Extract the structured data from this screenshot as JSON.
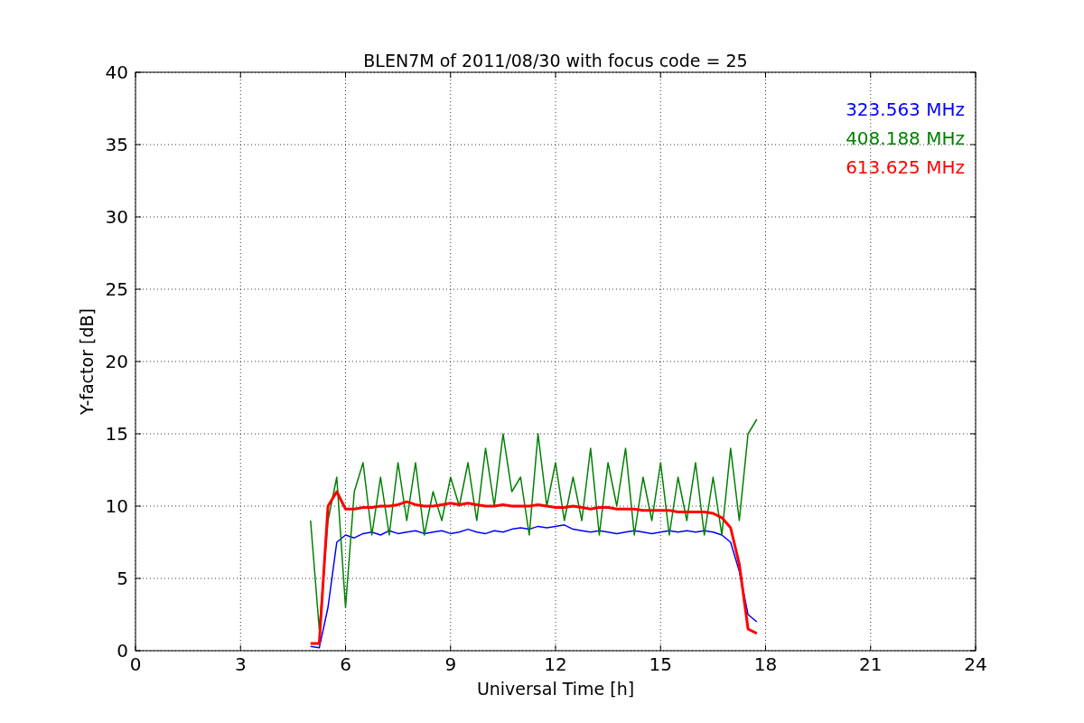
{
  "chart_data": {
    "type": "line",
    "grid": true,
    "title": "BLEN7M of 2011/08/30 with focus code = 25",
    "xlabel": "Universal Time [h]",
    "ylabel": "Y-factor [dB]",
    "xlim": [
      0,
      24
    ],
    "ylim": [
      0,
      40
    ],
    "xticks": [
      0,
      3,
      6,
      9,
      12,
      15,
      18,
      21,
      24
    ],
    "yticks": [
      0,
      5,
      10,
      15,
      20,
      25,
      30,
      35,
      40
    ],
    "x": [
      5,
      5.25,
      5.5,
      5.75,
      6,
      6.25,
      6.5,
      6.75,
      7,
      7.25,
      7.5,
      7.75,
      8,
      8.25,
      8.5,
      8.75,
      9,
      9.25,
      9.5,
      9.75,
      10,
      10.25,
      10.5,
      10.75,
      11,
      11.25,
      11.5,
      11.75,
      12,
      12.25,
      12.5,
      12.75,
      13,
      13.25,
      13.5,
      13.75,
      14,
      14.25,
      14.5,
      14.75,
      15,
      15.25,
      15.5,
      15.75,
      16,
      16.25,
      16.5,
      16.75,
      17,
      17.25,
      17.5,
      17.75
    ],
    "series": [
      {
        "name": "323.563 MHz",
        "color": "#0000ff",
        "values": [
          0.3,
          0.2,
          3,
          7.5,
          8,
          7.8,
          8.1,
          8.2,
          8.0,
          8.3,
          8.1,
          8.2,
          8.3,
          8.1,
          8.2,
          8.3,
          8.1,
          8.2,
          8.4,
          8.2,
          8.1,
          8.3,
          8.2,
          8.4,
          8.5,
          8.4,
          8.6,
          8.5,
          8.6,
          8.7,
          8.4,
          8.3,
          8.2,
          8.3,
          8.2,
          8.1,
          8.2,
          8.3,
          8.2,
          8.1,
          8.2,
          8.3,
          8.2,
          8.3,
          8.2,
          8.3,
          8.2,
          8.0,
          7.5,
          5.5,
          2.5,
          2
        ]
      },
      {
        "name": "408.188 MHz",
        "color": "#008000",
        "values": [
          9,
          1.5,
          9,
          12,
          3,
          11,
          13,
          8,
          12,
          8,
          13,
          9,
          13,
          8,
          11,
          9,
          12,
          10,
          13,
          9,
          14,
          10,
          15,
          11,
          12,
          8,
          15,
          10,
          13,
          9,
          12,
          9,
          14,
          8,
          13,
          10,
          14,
          8,
          12,
          9,
          13,
          8,
          12,
          9,
          13,
          8,
          12,
          8,
          14,
          9,
          15,
          16
        ]
      },
      {
        "name": "613.625 MHz",
        "color": "#ff0000",
        "values": [
          0.5,
          0.5,
          10,
          11,
          9.8,
          9.8,
          9.9,
          9.9,
          10,
          10,
          10.1,
          10.3,
          10.1,
          10,
          10,
          10.1,
          10.2,
          10.1,
          10.2,
          10.1,
          10,
          10,
          10.1,
          10,
          10,
          10,
          10.1,
          10,
          9.9,
          9.9,
          10,
          9.9,
          9.8,
          9.9,
          9.9,
          9.8,
          9.8,
          9.8,
          9.7,
          9.7,
          9.7,
          9.7,
          9.6,
          9.6,
          9.6,
          9.6,
          9.5,
          9.2,
          8.5,
          6,
          1.5,
          1.2
        ]
      }
    ]
  }
}
